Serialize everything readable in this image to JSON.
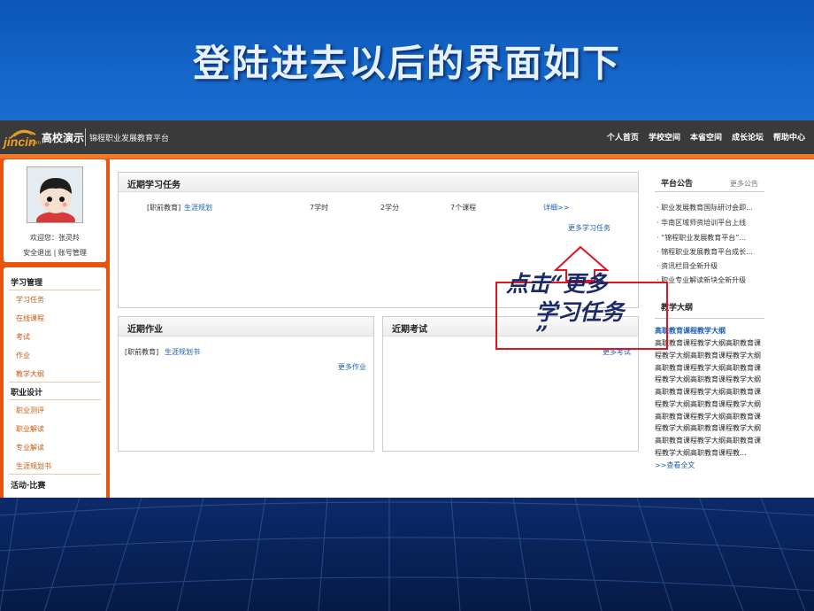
{
  "slide": {
    "title": "登陆进去以后的界面如下",
    "callout_line1": "点击“更多",
    "callout_line2": "学习任务",
    "callout_line3": "”"
  },
  "topbar": {
    "logo_text": "jincin",
    "logo_sub": ".com",
    "school": "高校演示",
    "platform": "锦程职业发展教育平台",
    "nav": [
      "个人首页",
      "学校空间",
      "本省空间",
      "成长论坛",
      "帮助中心"
    ]
  },
  "profile": {
    "welcome_label": "欢迎您：",
    "user_name": "张灵羚",
    "logout": "安全退出",
    "separator": "|",
    "account": "账号管理"
  },
  "sidebar": {
    "sections": [
      {
        "title": "学习管理",
        "items": [
          "学习任务",
          "在线课程",
          "考试",
          "作业",
          "教学大纲"
        ]
      },
      {
        "title": "职业设计",
        "items": [
          "职业测评",
          "职业解读",
          "专业解读",
          "生涯规划书"
        ]
      },
      {
        "title": "活动·比赛",
        "items": []
      }
    ]
  },
  "tasks": {
    "title": "近期学习任务",
    "row": {
      "category": "[职前教育]",
      "name": "生涯规划",
      "hours": "7学时",
      "credits": "2学分",
      "courses": "7个课程",
      "detail": "详细>>"
    },
    "more": "更多学习任务"
  },
  "homework": {
    "title": "近期作业",
    "category": "[职前教育]",
    "name": "生涯规划书",
    "more": "更多作业"
  },
  "exam": {
    "title": "近期考试",
    "more": "更多考试"
  },
  "announcements": {
    "title": "平台公告",
    "more": "更多公告",
    "items": [
      "职业发展教育国际研讨会即...",
      "华南区域师资培训平台上线",
      "“锦程职业发展教育平台”...",
      "锦程职业发展教育平台成长...",
      "资讯栏目全新升级",
      "职业专业解读新块全新升级"
    ]
  },
  "syllabus": {
    "title": "教学大纲",
    "heading": "高职教育课程教学大纲",
    "lines": [
      "高职教育课程教学大纲高职教育课",
      "程教学大纲高职教育课程教学大纲",
      "高职教育课程教学大纲高职教育课",
      "程教学大纲高职教育课程教学大纲",
      "高职教育课程教学大纲高职教育课",
      "程教学大纲高职教育课程教学大纲",
      "高职教育课程教学大纲高职教育课",
      "程教学大纲高职教育课程教学大纲",
      "高职教育课程教学大纲高职教育课",
      "程教学大纲高职教育课程教..."
    ],
    "read_all": ">>查看全文"
  },
  "colors": {
    "accent_orange": "#e8540e",
    "link_blue": "#1a5fb4",
    "annotation_red": "#e0141e"
  }
}
